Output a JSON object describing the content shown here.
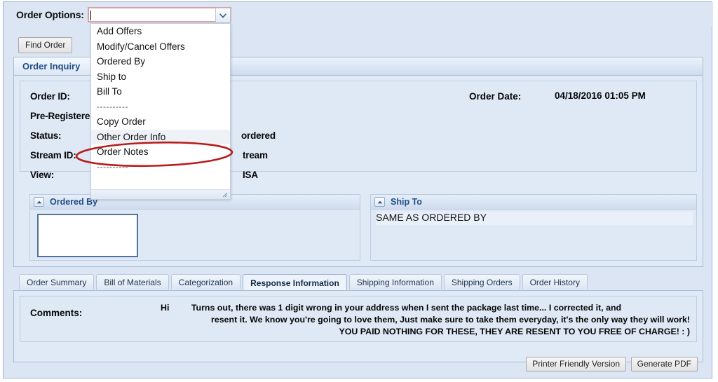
{
  "toolbar": {
    "order_options_label": "Order Options:",
    "order_options_value": "",
    "order_options_placeholder": "",
    "find_order_label": "Find Order"
  },
  "dropdown": {
    "items": [
      {
        "label": "Add Offers",
        "type": "item",
        "highlighted": false
      },
      {
        "label": "Modify/Cancel Offers",
        "type": "item",
        "highlighted": false
      },
      {
        "label": "Ordered By",
        "type": "item",
        "highlighted": false
      },
      {
        "label": "Ship to",
        "type": "item",
        "highlighted": false
      },
      {
        "label": "Bill To",
        "type": "item",
        "highlighted": false
      },
      {
        "label": "----------",
        "type": "separator",
        "highlighted": false
      },
      {
        "label": "Copy Order",
        "type": "item",
        "highlighted": false
      },
      {
        "label": "Other Order Info",
        "type": "item",
        "highlighted": true
      },
      {
        "label": "Order Notes",
        "type": "item",
        "highlighted": false
      },
      {
        "label": "----------",
        "type": "separator",
        "highlighted": false
      }
    ]
  },
  "annotation": {
    "target": "Other Order Info",
    "shape": "ellipse",
    "color": "#b81c1c"
  },
  "panel": {
    "title": "Order Inquiry",
    "fields": [
      {
        "label": "Order ID:",
        "value": ""
      },
      {
        "label": "Pre-Registered",
        "value": ""
      },
      {
        "label": "Status:",
        "value": "ordered"
      },
      {
        "label": "Stream ID:",
        "value": "tream"
      },
      {
        "label": "View:",
        "value": "ISA"
      }
    ],
    "order_date_label": "Order Date:",
    "order_date_value": "04/18/2016 01:05 PM"
  },
  "ordered_by": {
    "title": "Ordered By",
    "value": ""
  },
  "ship_to": {
    "title": "Ship To",
    "value": "SAME AS ORDERED BY"
  },
  "tabs": [
    {
      "label": "Order Summary",
      "active": false
    },
    {
      "label": "Bill of Materials",
      "active": false
    },
    {
      "label": "Categorization",
      "active": false
    },
    {
      "label": "Response Information",
      "active": true
    },
    {
      "label": "Shipping Information",
      "active": false
    },
    {
      "label": "Shipping Orders",
      "active": false
    },
    {
      "label": "Order History",
      "active": false
    }
  ],
  "comments": {
    "label": "Comments:",
    "greeting": "Hi",
    "line1": "Turns out, there was 1 digit wrong in your address when I sent the package last time... I corrected it, and",
    "line2": "resent it. We know you're going to love them, Just make sure to take them everyday, it's the only way they will work!",
    "line3": "YOU PAID NOTHING FOR THESE, THEY ARE RESENT TO YOU FREE OF CHARGE! : )"
  },
  "footer": {
    "printer_friendly_label": "Printer Friendly Version",
    "generate_pdf_label": "Generate PDF"
  },
  "colors": {
    "window_background": "#dbe5f3",
    "panel_background": "#e0e9f6",
    "panel_title": "#1f4e85",
    "combo_border": "#d8a0a0",
    "annotation_red": "#b81c1c",
    "redaction_border": "#51729a"
  }
}
